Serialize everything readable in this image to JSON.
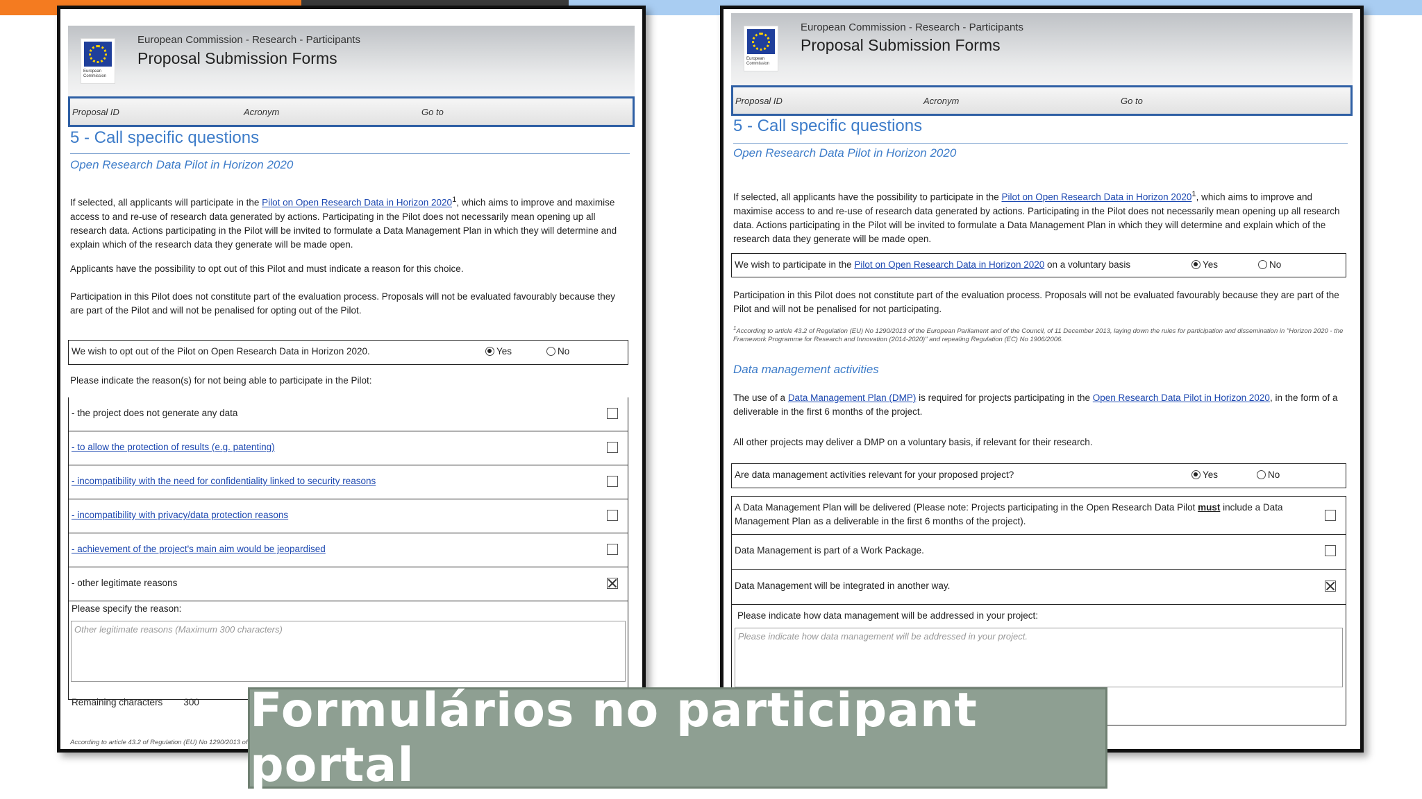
{
  "header": {
    "subtitle": "European Commission - Research - Participants",
    "title": "Proposal Submission Forms",
    "logo_text": "European Commission"
  },
  "idbar": {
    "proposal_id": "Proposal ID",
    "acronym": "Acronym",
    "goto": "Go to"
  },
  "section": {
    "title": "5 - Call specific questions",
    "subtitle": "Open Research Data Pilot in Horizon 2020"
  },
  "left": {
    "p1_a": "If selected, all applicants will participate in the ",
    "p1_link": "Pilot on Open Research Data in Horizon 2020",
    "p1_sup": "1",
    "p1_b": ", which aims to improve and maximise access to and re-use of research data generated by actions. Participating in the Pilot does not necessarily mean opening up all research data. Actions participating in the Pilot will be invited to formulate a Data Management Plan in which they will determine and explain which of the research data they generate will be made open.",
    "p2": "Applicants have the possibility to opt out of this Pilot and must indicate a reason for this choice.",
    "p3": "Participation in this Pilot does not constitute part of the evaluation process. Proposals will not be evaluated favourably because they are part of the Pilot and will not be penalised for opting out of the Pilot.",
    "optout_question": "We wish to opt out of the Pilot on Open Research Data in Horizon 2020.",
    "yes": "Yes",
    "no": "No",
    "reasons_prompt": "Please indicate the reason(s) for not being able to participate in the Pilot:",
    "reasons": [
      {
        "label": "- the project does not generate any data",
        "link": false,
        "checked": false
      },
      {
        "label": "- to allow the protection of results (e.g. patenting)",
        "link": true,
        "checked": false
      },
      {
        "label": "- incompatibility with the need for confidentiality linked to security reasons",
        "link": true,
        "checked": false
      },
      {
        "label": "- incompatibility with privacy/data protection reasons",
        "link": true,
        "checked": false
      },
      {
        "label": "- achievement of the project's main aim would be jeopardised",
        "link": true,
        "checked": false
      },
      {
        "label": "- other legitimate reasons",
        "link": false,
        "checked": true
      }
    ],
    "specify": "Please specify the reason:",
    "textarea_placeholder": "Other legitimate reasons (Maximum 300 characters)",
    "remaining_label": "Remaining characters",
    "remaining_value": "300",
    "footnote": "According to article 43.2 of Regulation (EU) No 1290/2013 of"
  },
  "right": {
    "p1_a": "If selected, all applicants have the possibility to participate in the ",
    "p1_link": "Pilot on Open Research Data in Horizon 2020",
    "p1_sup": "1",
    "p1_b": ", which aims to improve and maximise access to and re-use of research data generated by actions. Participating in the Pilot does not necessarily mean opening up all research data. Actions participating in the Pilot will be invited to formulate a Data Management Plan in which they will determine and explain which of the research data they generate will be made open.",
    "wish_a": "We wish to participate in the ",
    "wish_link": "Pilot on Open Research Data in Horizon 2020",
    "wish_b": " on a voluntary basis",
    "yes": "Yes",
    "no": "No",
    "p2": "Participation in this Pilot does not constitute part of the evaluation process. Proposals will not be evaluated favourably because they are part of the Pilot and will not be penalised for not participating.",
    "footnote": "According to article 43.2 of Regulation (EU) No 1290/2013 of the European Parliament and of the Council, of 11 December 2013, laying down the rules for participation and dissemination in \"Horizon 2020 - the Framework Programme for Research and Innovation (2014-2020)\" and repealing Regulation (EC) No 1906/2006.",
    "dm_title": "Data management activities",
    "dm_p1_a": "The use of a ",
    "dm_p1_link1": "Data Management Plan (DMP)",
    "dm_p1_b": " is required for projects participating in the ",
    "dm_p1_link2": "Open Research Data Pilot in Horizon 2020",
    "dm_p1_c": ", in the form of a deliverable in the first 6 months of the project.",
    "dm_p2": "All other projects may deliver a DMP on a voluntary basis,  if relevant for their research.",
    "dm_question": "Are data management activities relevant for your proposed project?",
    "opt1_a": "A Data Management Plan will be delivered (Please note: Projects participating in the Open Research Data Pilot ",
    "opt1_must": "must",
    "opt1_b": " include a Data Management Plan as a deliverable in the first 6 months of the project).",
    "opt2": "Data Management is part of a Work Package.",
    "opt3": "Data Management will be integrated in another way.",
    "indicate": "Please indicate how data management will be addressed in your project:",
    "textarea_placeholder": "Please indicate how data management will be addressed in your project."
  },
  "banner": {
    "text": "Formulários no participant portal"
  }
}
